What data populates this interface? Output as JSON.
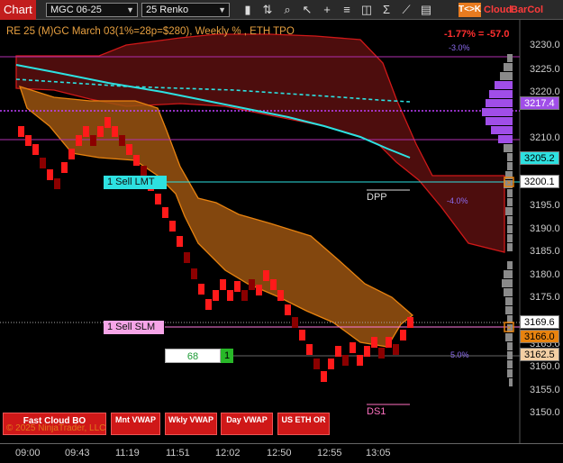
{
  "toolbar": {
    "chart_tab": "Chart",
    "instrument": "MGC 06-25",
    "bar_type": "25 Renko",
    "tk_badge": "T<>K",
    "cloud_label": "Cloud",
    "barcol_label": "BarCol",
    "icons": [
      "bar-style-icon",
      "draw-tools-icon",
      "zoom-icon",
      "pointer-icon",
      "crosshair-icon",
      "text-tool-icon",
      "measure-icon",
      "indicator-icon",
      "strategy-icon",
      "properties-icon"
    ]
  },
  "chart": {
    "title": "RE 25 (M)GC March 03(1%=28p=$280), Weekly % , ETH TPO",
    "pct_change": "-1.77% = -57.0",
    "level_labels": [
      "-3.0%",
      "-4.0%",
      "5.0%"
    ],
    "dpp_label": "DPP",
    "ds1_label": "DS1",
    "price_axis": [
      "3230.0",
      "3225.0",
      "3220.0",
      "3210.0",
      "3195.0",
      "3190.0",
      "3185.0",
      "3180.0",
      "3175.0",
      "3165.0",
      "3160.0",
      "3155.0",
      "3150.0"
    ],
    "price_flags": {
      "vwap_level": "3217.4",
      "cyan_level": "3205.2",
      "limit_level": "3200.1",
      "current_price": "3169.6",
      "sell_slm_level": "3166.0",
      "orange_level": "3162.5"
    },
    "colors": {
      "red_cloud": "#8b1a1a",
      "orange_cloud": "#b8680f",
      "brick_red": "#ff1a1a",
      "brick_dark": "#8b0000",
      "cyan": "#2de1e1",
      "purple": "#a04ee8"
    }
  },
  "orders": {
    "limit_label": "1 Sell LMT",
    "slm_label": "1 Sell SLM",
    "quantity": "68",
    "qty_button": "1"
  },
  "bottom": {
    "buttons": [
      "Fast Cloud BO",
      "Mnt VWAP",
      "Wkly VWAP",
      "Day VWAP",
      "US ETH OR"
    ],
    "copyright": "© 2025 NinjaTrader, LLC"
  },
  "time_axis": [
    "09:00",
    "09:43",
    "11:19",
    "11:51",
    "12:02",
    "12:50",
    "12:55",
    "13:05"
  ]
}
